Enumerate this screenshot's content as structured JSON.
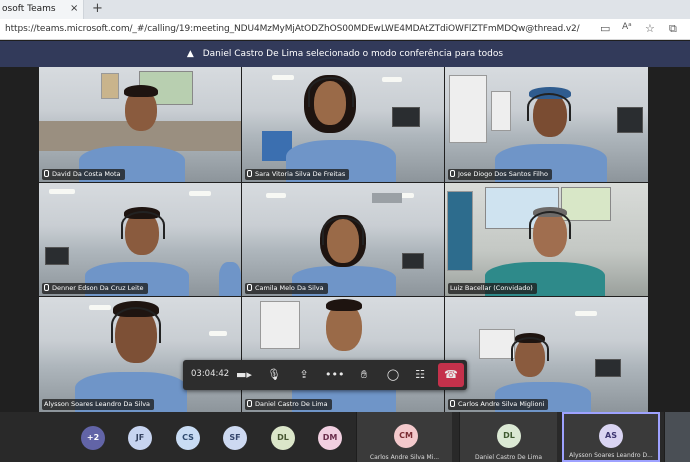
{
  "browser": {
    "tab_title": "osoft Teams",
    "tab_close": "×",
    "new_tab": "+",
    "url": "https://teams.microsoft.com/_#/calling/19:meeting_NDU4MzMyMjAtODZhOS00MDEwLWE4MDAtZTdiOWFlZTFmMDQw@thread.v2/"
  },
  "notification": {
    "text": "Daniel Castro De Lima selecionado o modo conferência para todos"
  },
  "tiles": [
    {
      "name": "David Da Costa Mota"
    },
    {
      "name": "Sara Vitoria Silva De Freitas"
    },
    {
      "name": "Jose Diogo Dos Santos Filho"
    },
    {
      "name": "Denner Edson Da Cruz Leite"
    },
    {
      "name": "Camila Melo Da Silva"
    },
    {
      "name": "Luiz Bacellar (Convidado)"
    },
    {
      "name": "Alysson Soares Leandro Da Silva"
    },
    {
      "name": "Daniel Castro De Lima"
    },
    {
      "name": "Carlos Andre Silva Miglioni"
    }
  ],
  "controls": {
    "timer": "03:04:42"
  },
  "participants": {
    "overflow": "+2",
    "avatars": [
      {
        "initials": "JF",
        "bg": "#c7d4f0",
        "fg": "#33405e"
      },
      {
        "initials": "CS",
        "bg": "#c9dcf4",
        "fg": "#2f4a6e"
      },
      {
        "initials": "SF",
        "bg": "#cdd9f1",
        "fg": "#34456c"
      },
      {
        "initials": "DL",
        "bg": "#dbe6c9",
        "fg": "#465530"
      },
      {
        "initials": "DM",
        "bg": "#f1cfe0",
        "fg": "#6a2d4b"
      }
    ],
    "strips": [
      {
        "initials": "CM",
        "name": "Carlos Andre Silva Mi...",
        "bg": "#f3c9cc",
        "fg": "#7a2d33"
      },
      {
        "initials": "DL",
        "name": "Daniel Castro De Lima",
        "bg": "#dbe9d4",
        "fg": "#3e5a30"
      },
      {
        "initials": "AS",
        "name": "Alysson Soares Leandro D...",
        "bg": "#d9d4f2",
        "fg": "#3b3470"
      }
    ],
    "overflow_color": "#6264a7"
  }
}
